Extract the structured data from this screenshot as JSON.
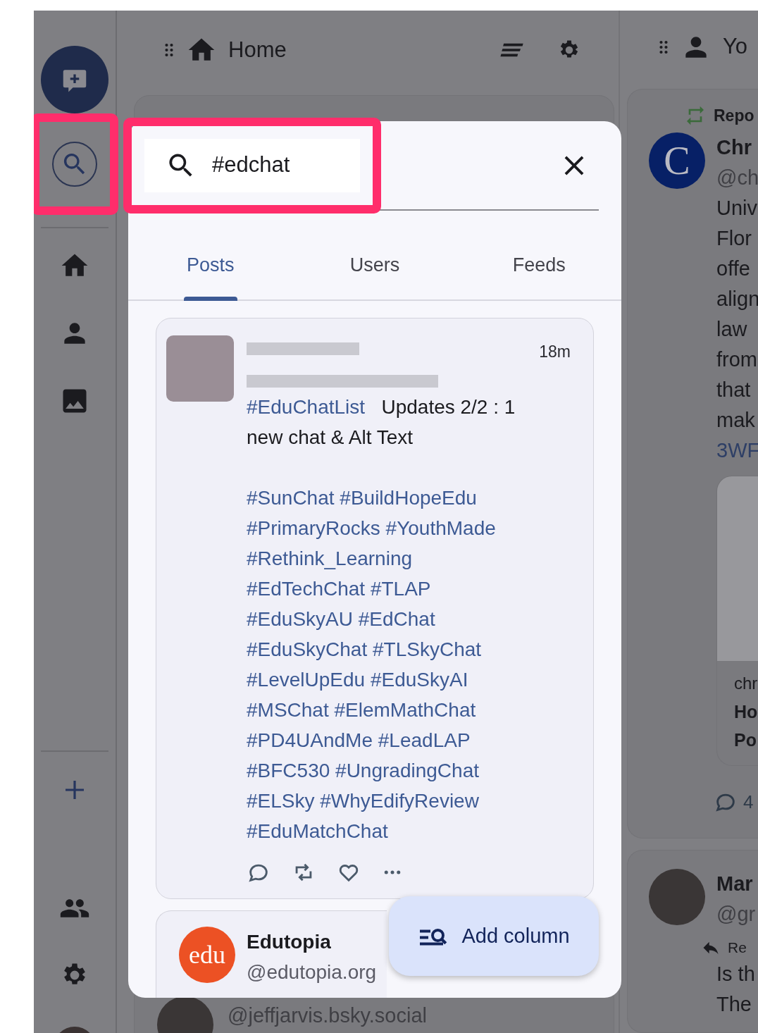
{
  "sidebar": {
    "top_items": [
      {
        "kind": "compose"
      },
      {
        "kind": "search",
        "highlighted": true
      }
    ],
    "nav_items": [
      {
        "kind": "home"
      },
      {
        "kind": "profile"
      },
      {
        "kind": "media"
      }
    ],
    "bottom_items": [
      {
        "kind": "add"
      },
      {
        "kind": "people"
      },
      {
        "kind": "settings"
      },
      {
        "kind": "avatar"
      }
    ]
  },
  "columns": [
    {
      "kind": "home",
      "title": "Home",
      "posts": [
        {
          "handle": "@jeffjarvis.bsky.social"
        }
      ]
    },
    {
      "kind": "profile",
      "title": "Yo",
      "posts": [
        {
          "repost_label": "Repo",
          "avatar_letter": "C",
          "name": "Chr",
          "handle": "@ch",
          "lines": [
            "Univ",
            "Flor",
            "offe",
            "align",
            "law",
            "from",
            "that",
            "mak"
          ],
          "link": "3WF",
          "embed": {
            "lines": [
              "chr",
              "Ho",
              "Po"
            ]
          },
          "reply_count": "4"
        },
        {
          "reply_label": "Re",
          "name": "Mar",
          "handle": "@gr",
          "lines": [
            "Is th",
            "The"
          ]
        }
      ]
    }
  ],
  "search_dialog": {
    "query": "#edchat",
    "highlighted": true,
    "tabs": [
      {
        "label": "Posts",
        "selected": true
      },
      {
        "label": "Users",
        "selected": false
      },
      {
        "label": "Feeds",
        "selected": false
      }
    ],
    "results": [
      {
        "kind": "post",
        "time": "18m",
        "paragraphs": [
          {
            "kind": "wrapped",
            "segments": [
              {
                "kind": "hashtag",
                "text": "#EduChatList"
              },
              {
                "kind": "text",
                "text": "Updates 2/2 : 1 new chat & Alt Text"
              }
            ]
          },
          {
            "kind": "lines",
            "lines": [
              [
                {
                  "kind": "hashtag",
                  "text": "#SunChat"
                },
                {
                  "kind": "hashtag",
                  "text": "#BuildHopeEdu"
                }
              ],
              [
                {
                  "kind": "hashtag",
                  "text": "#PrimaryRocks"
                },
                {
                  "kind": "hashtag",
                  "text": "#YouthMade"
                }
              ],
              [
                {
                  "kind": "hashtag",
                  "text": "#Rethink_Learning"
                }
              ],
              [
                {
                  "kind": "hashtag",
                  "text": "#EdTechChat"
                },
                {
                  "kind": "hashtag",
                  "text": "#TLAP"
                }
              ],
              [
                {
                  "kind": "hashtag",
                  "text": "#EduSkyAU"
                },
                {
                  "kind": "hashtag",
                  "text": "#EdChat"
                }
              ],
              [
                {
                  "kind": "hashtag",
                  "text": "#EduSkyChat"
                },
                {
                  "kind": "hashtag",
                  "text": "#TLSkyChat"
                }
              ],
              [
                {
                  "kind": "hashtag",
                  "text": "#LevelUpEdu"
                },
                {
                  "kind": "hashtag",
                  "text": "#EduSkyAI"
                }
              ],
              [
                {
                  "kind": "hashtag",
                  "text": "#MSChat"
                },
                {
                  "kind": "hashtag",
                  "text": "#ElemMathChat"
                }
              ],
              [
                {
                  "kind": "hashtag",
                  "text": "#PD4UAndMe"
                },
                {
                  "kind": "hashtag",
                  "text": "#LeadLAP"
                }
              ],
              [
                {
                  "kind": "hashtag",
                  "text": "#BFC530"
                },
                {
                  "kind": "hashtag",
                  "text": "#UngradingChat"
                }
              ],
              [
                {
                  "kind": "hashtag",
                  "text": "#ELSky"
                },
                {
                  "kind": "hashtag",
                  "text": "#WhyEdifyReview"
                }
              ],
              [
                {
                  "kind": "hashtag",
                  "text": "#EduMatchChat"
                }
              ]
            ]
          }
        ]
      },
      {
        "kind": "user",
        "logo_text": "edu",
        "name": "Edutopia",
        "handle": "@edutopia.org"
      }
    ],
    "add_column_button": {
      "label": "Add column"
    }
  }
}
